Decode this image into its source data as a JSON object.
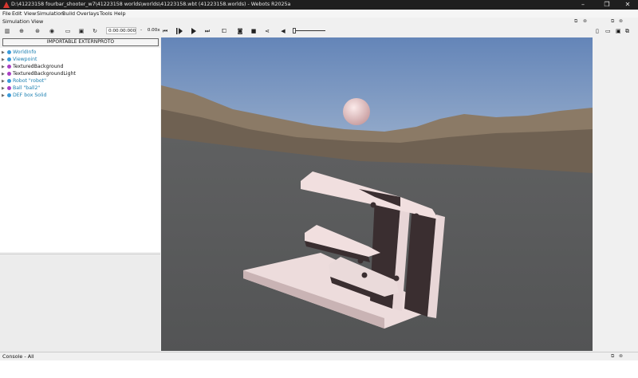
{
  "window": {
    "title": "D:\\41223158 fourbar_shooter_w7\\41223158 worlds\\worlds\\41223158.wbt (41223158.worlds) - Webots R2025a",
    "controls": [
      "–",
      "❐",
      "✕"
    ]
  },
  "menu": [
    "File",
    "Edit",
    "View",
    "Simulation",
    "Build",
    "Overlays",
    "Tools",
    "Help"
  ],
  "simulation_view": {
    "label": "Simulation View",
    "time": "0:00:00:000",
    "speed_prefix": "-",
    "speed": "0.00x"
  },
  "extern_proto_button": "IMPORTABLE EXTERNPROTO",
  "scene_tree": [
    {
      "label": "WorldInfo",
      "color": "#3a9ad9",
      "text_color": "#1a7fb0"
    },
    {
      "label": "Viewpoint",
      "color": "#3a9ad9",
      "text_color": "#1a7fb0"
    },
    {
      "label": "TexturedBackground",
      "color": "#a93fc4",
      "text_color": "#111111"
    },
    {
      "label": "TexturedBackgroundLight",
      "color": "#a93fc4",
      "text_color": "#111111"
    },
    {
      "label": "Robot \"robot\"",
      "color": "#3a9ad9",
      "text_color": "#1a7fb0"
    },
    {
      "label": "Ball \"ball2\"",
      "color": "#a93fc4",
      "text_color": "#1a7fb0"
    },
    {
      "label": "DEF box Solid",
      "color": "#3a9ad9",
      "text_color": "#1a7fb0"
    }
  ],
  "console": {
    "label": "Console - All"
  },
  "colors": {
    "titlebar": "#1f1f1f",
    "sky_top": "#6f8dbb",
    "ground": "#595a5b",
    "robot": "#f1dede",
    "robot_dark": "#3c2f31",
    "ball": "#e6c9c9"
  },
  "icons": [
    "webots-icon",
    "scene-tree-icon",
    "add-node-icon",
    "reset-icon",
    "view-icon",
    "open-icon",
    "save-icon",
    "reload-icon",
    "step-back-icon",
    "play-icon",
    "step-icon",
    "fast-forward-icon",
    "render-icon",
    "record-icon",
    "stop-icon",
    "share-icon",
    "volume-icon",
    "new-file-icon",
    "open-file-icon",
    "save-file-icon"
  ]
}
